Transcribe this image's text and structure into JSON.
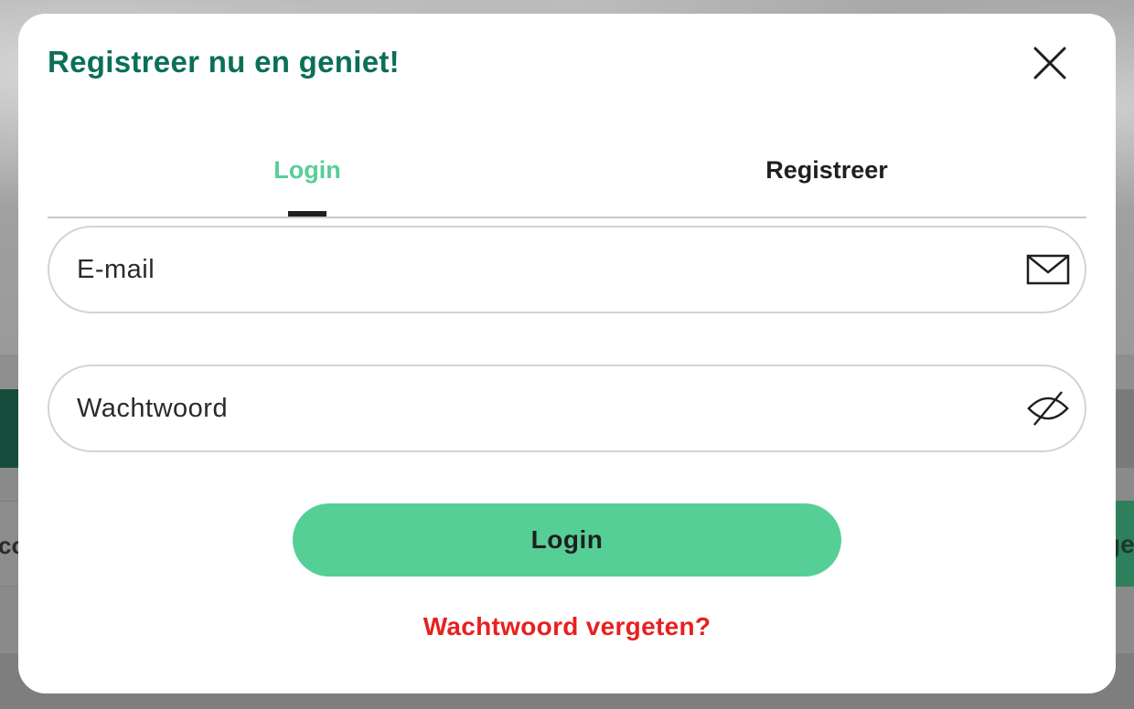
{
  "background": {
    "row_text_left": "co",
    "row_text_right": "ge"
  },
  "modal": {
    "title": "Registreer nu en geniet!",
    "close_icon": "close-icon",
    "tabs": [
      {
        "label": "Login",
        "active": true
      },
      {
        "label": "Registreer",
        "active": false
      }
    ],
    "email": {
      "placeholder": "E-mail",
      "value": "",
      "icon": "envelope-icon"
    },
    "password": {
      "placeholder": "Wachtwoord",
      "value": "",
      "icon": "eye-off-icon"
    },
    "login_button": "Login",
    "forgot_link": "Wachtwoord vergeten?"
  },
  "colors": {
    "title_green": "#0a7057",
    "accent_green": "#56cf97",
    "link_red": "#e8201f",
    "text_dark": "#1f1f1f"
  }
}
